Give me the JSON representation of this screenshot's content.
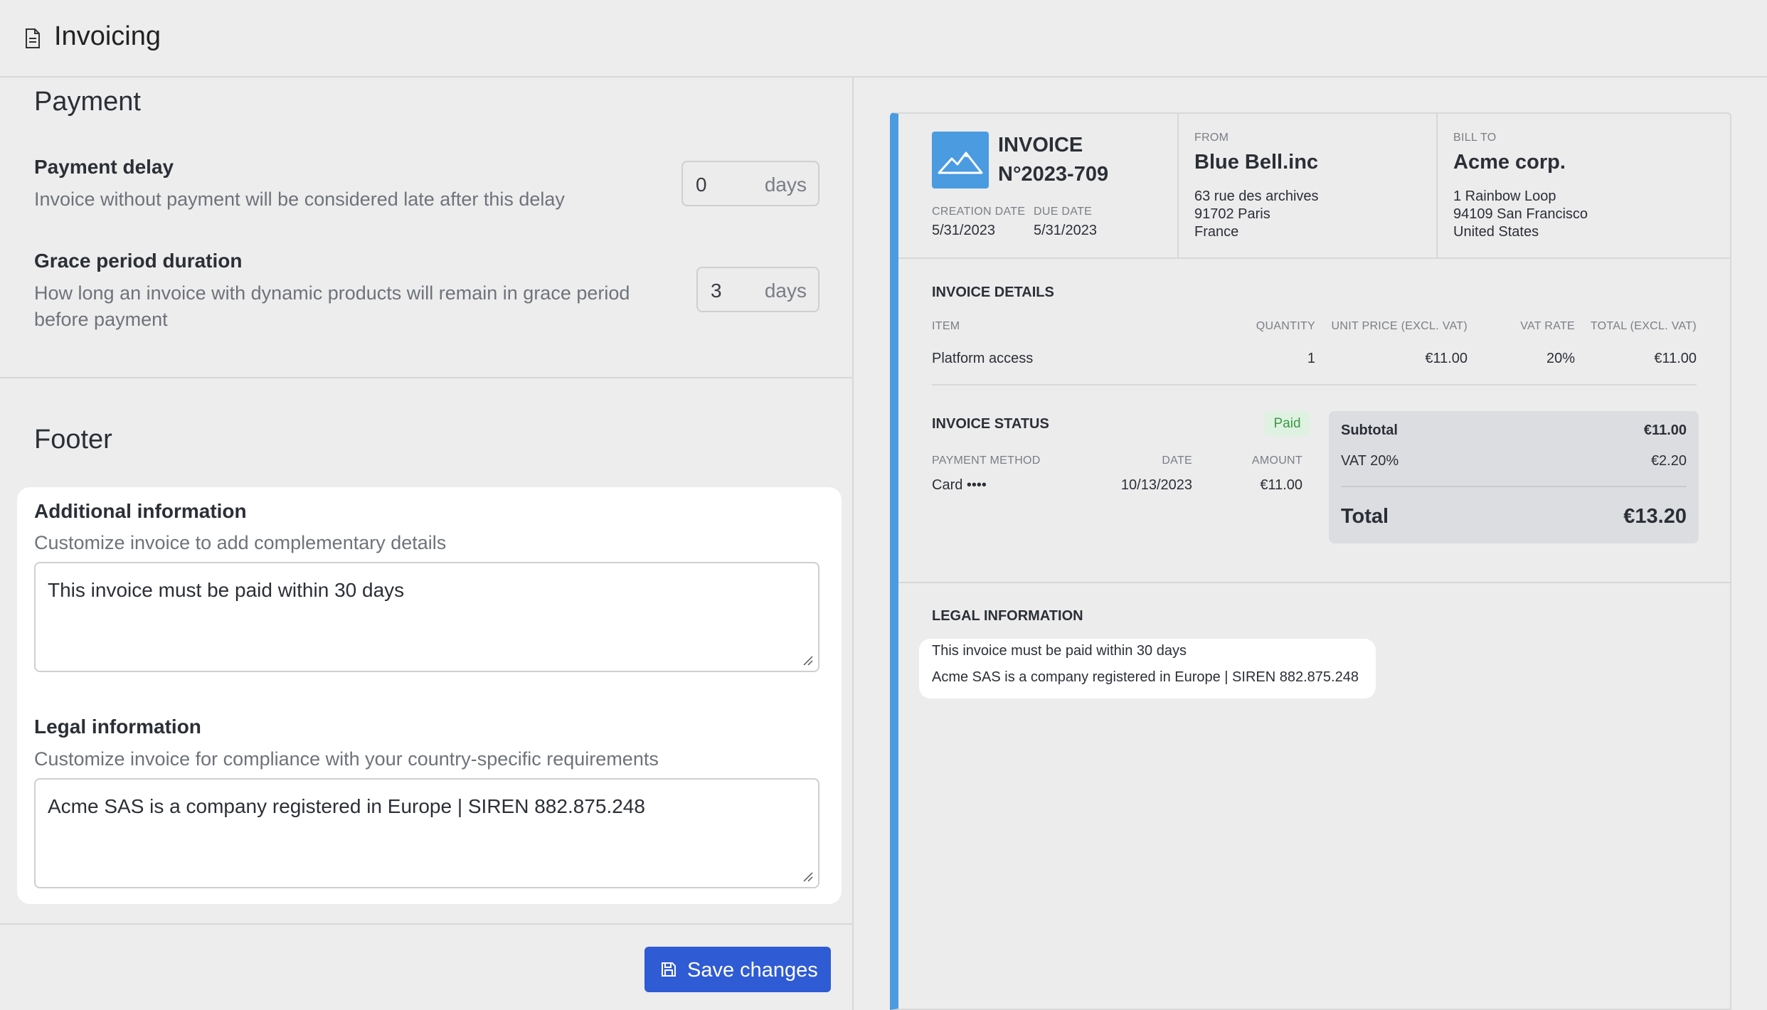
{
  "header": {
    "title": "Invoicing",
    "icon": "document-icon"
  },
  "payment": {
    "section_title": "Payment",
    "delay": {
      "label": "Payment delay",
      "help": "Invoice without payment will be considered late after this delay",
      "value": "0",
      "unit": "days"
    },
    "grace": {
      "label": "Grace period duration",
      "help": "How long an invoice with dynamic products will remain in grace period before payment",
      "value": "3",
      "unit": "days"
    }
  },
  "footer": {
    "section_title": "Footer",
    "additional": {
      "label": "Additional information",
      "help": "Customize invoice to add complementary details",
      "value": "This invoice must be paid within 30 days"
    },
    "legal": {
      "label": "Legal information",
      "help": "Customize invoice for compliance with your country-specific requirements",
      "value": "Acme SAS is a company registered in Europe | SIREN 882.875.248"
    }
  },
  "save_label": "Save changes",
  "invoice": {
    "title_line1": "INVOICE",
    "title_line2": "N°2023-709",
    "creation_label": "CREATION DATE",
    "creation_date": "5/31/2023",
    "due_label": "DUE DATE",
    "due_date": "5/31/2023",
    "from_label": "FROM",
    "from_name": "Blue Bell.inc",
    "from_addr1": "63 rue des archives",
    "from_addr2": "91702 Paris",
    "from_addr3": "France",
    "bill_label": "BILL TO",
    "bill_name": "Acme corp.",
    "bill_addr1": "1 Rainbow Loop",
    "bill_addr2": "94109 San Francisco",
    "bill_addr3": "United States",
    "details_title": "INVOICE DETAILS",
    "columns": {
      "item": "ITEM",
      "quantity": "QUANTITY",
      "unit_price": "UNIT PRICE (EXCL. VAT)",
      "vat_rate": "VAT RATE",
      "total": "TOTAL (EXCL. VAT)"
    },
    "line": {
      "item": "Platform access",
      "quantity": "1",
      "unit_price": "€11.00",
      "vat_rate": "20%",
      "total": "€11.00"
    },
    "status_title": "INVOICE STATUS",
    "status_badge": "Paid",
    "pay_cols": {
      "method": "PAYMENT METHOD",
      "date": "DATE",
      "amount": "AMOUNT"
    },
    "payment": {
      "method": "Card ••••",
      "date": "10/13/2023",
      "amount": "€11.00"
    },
    "subtotal_label": "Subtotal",
    "subtotal": "€11.00",
    "vat_label": "VAT 20%",
    "vat": "€2.20",
    "total_label": "Total",
    "total": "€13.20",
    "legal_title": "LEGAL INFORMATION",
    "legal_line1": "This invoice must be paid within 30 days",
    "legal_line2": "Acme SAS is a company registered in Europe | SIREN 882.875.248",
    "accent_color": "#4a9be0"
  }
}
